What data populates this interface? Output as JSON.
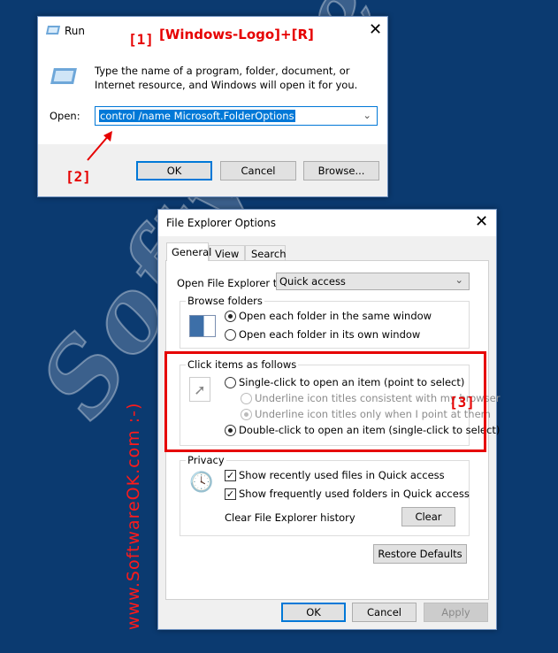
{
  "background_color": "#0b3a70",
  "watermark": {
    "diagonal": "SoftwareOK.com",
    "vertical": "www.SoftwareOK.com :-)"
  },
  "annotations": {
    "step1": "[1]",
    "shortcut": "[Windows-Logo]+[R]",
    "step2": "[2]",
    "step3": "[3]",
    "color": "#e60000"
  },
  "run_dialog": {
    "title": "Run",
    "description": "Type the name of a program, folder, document, or Internet resource, and Windows will open it for you.",
    "open_label": "Open:",
    "open_value": "control /name Microsoft.FolderOptions",
    "buttons": {
      "ok": "OK",
      "cancel": "Cancel",
      "browse": "Browse..."
    }
  },
  "options_dialog": {
    "title": "File Explorer Options",
    "tabs": [
      {
        "label": "General",
        "active": true
      },
      {
        "label": "View"
      },
      {
        "label": "Search"
      }
    ],
    "open_to_label": "Open File Explorer to:",
    "open_to_value": "Quick access",
    "browse_folders": {
      "title": "Browse folders",
      "options": [
        {
          "label": "Open each folder in the same window",
          "checked": true
        },
        {
          "label": "Open each folder in its own window",
          "checked": false
        }
      ]
    },
    "click_items": {
      "title": "Click items as follows",
      "single": {
        "label": "Single-click to open an item (point to select)",
        "checked": false
      },
      "underline1": {
        "label": "Underline icon titles consistent with my browser",
        "checked": false,
        "disabled": true
      },
      "underline2": {
        "label": "Underline icon titles only when I point at them",
        "checked": true,
        "disabled": true
      },
      "double": {
        "label": "Double-click to open an item (single-click to select)",
        "checked": true
      }
    },
    "privacy": {
      "title": "Privacy",
      "recent": {
        "label": "Show recently used files in Quick access",
        "checked": true
      },
      "frequent": {
        "label": "Show frequently used folders in Quick access",
        "checked": true
      },
      "clear_label": "Clear File Explorer history",
      "clear_button": "Clear"
    },
    "restore_button": "Restore Defaults",
    "buttons": {
      "ok": "OK",
      "cancel": "Cancel",
      "apply": "Apply"
    }
  }
}
